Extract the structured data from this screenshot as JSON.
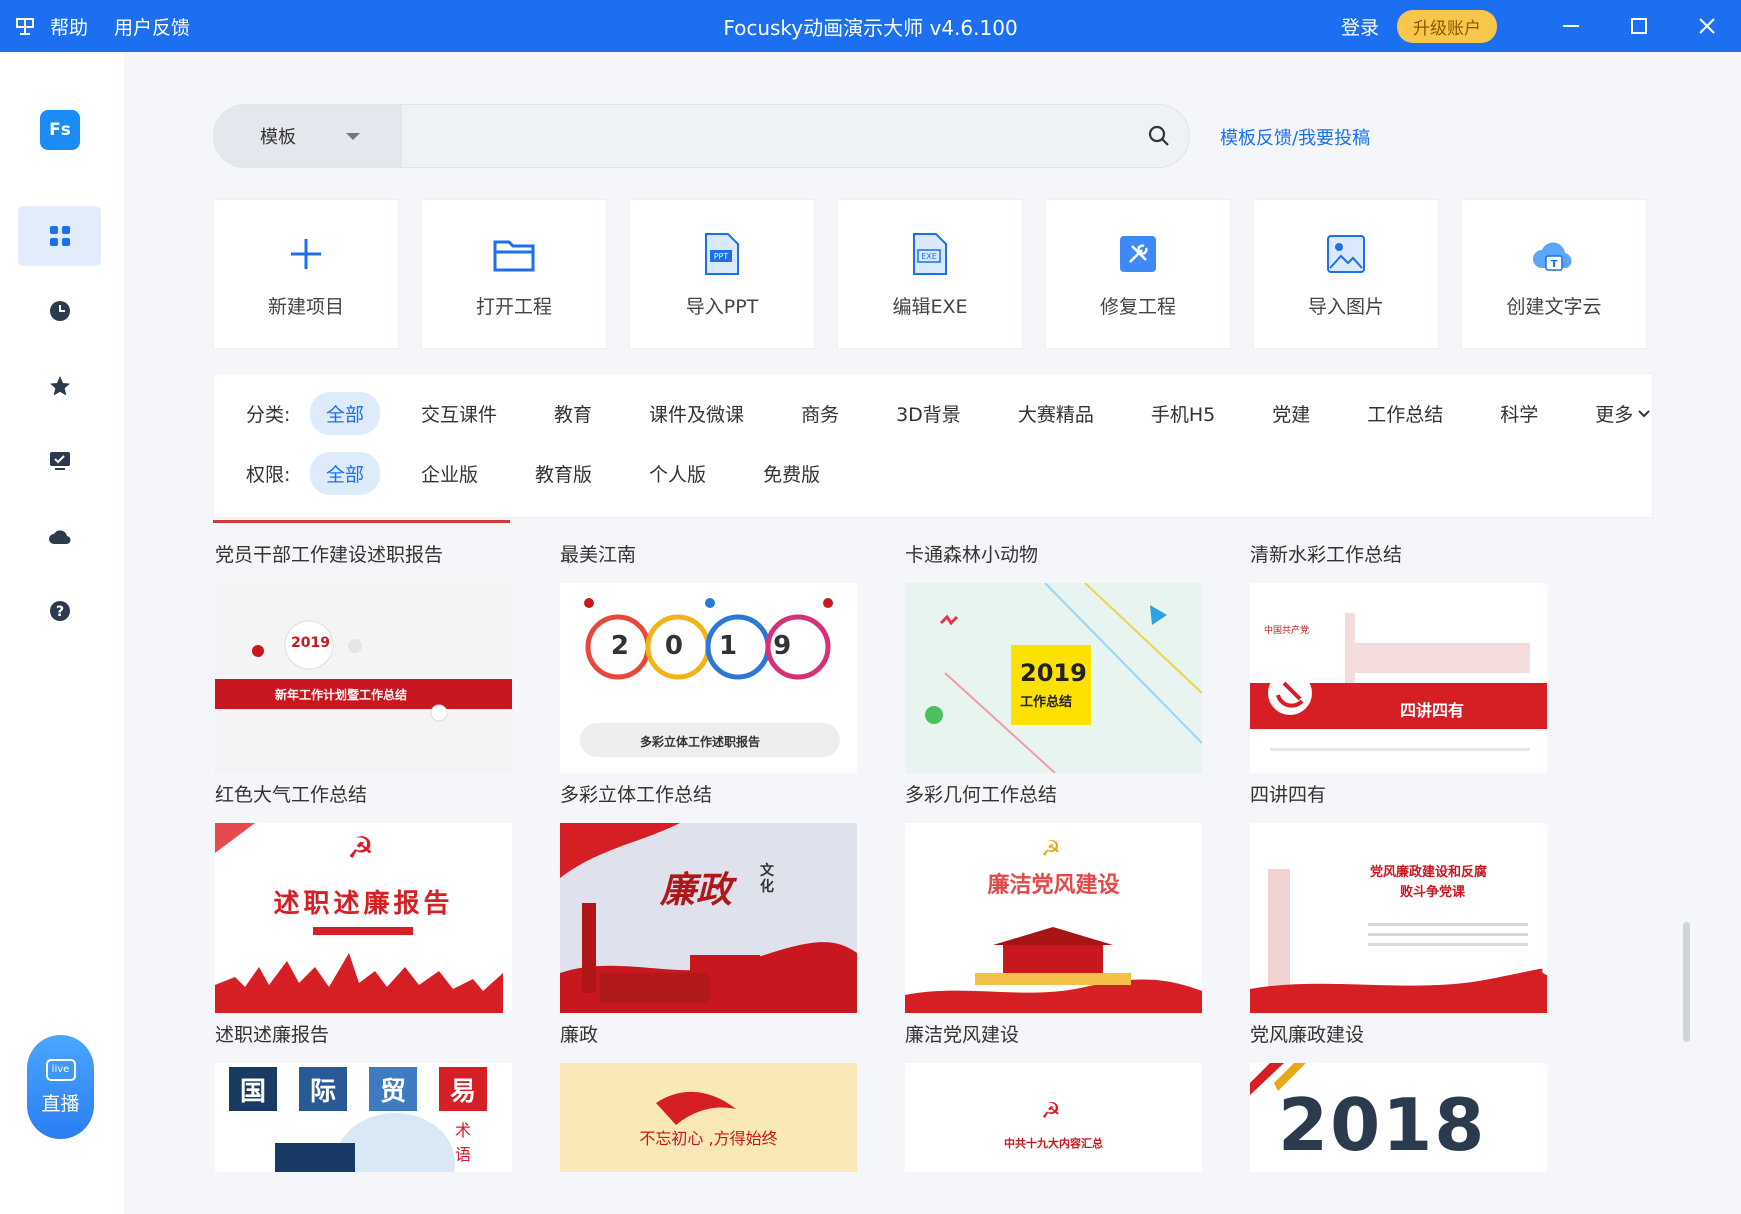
{
  "titlebar": {
    "menu": [
      "帮助",
      "用户反馈"
    ],
    "title": "Focusky动画演示大师 v4.6.100",
    "login": "登录",
    "upgrade": "升级账户"
  },
  "sidebar": {
    "logo": "Fs",
    "live_label": "直播",
    "live_badge": "live"
  },
  "search": {
    "type": "模板",
    "placeholder": "",
    "feedback_link": "模板反馈/我要投稿"
  },
  "actions": [
    {
      "label": "新建项目",
      "icon": "plus-icon"
    },
    {
      "label": "打开工程",
      "icon": "folder-icon"
    },
    {
      "label": "导入PPT",
      "icon": "ppt-file-icon"
    },
    {
      "label": "编辑EXE",
      "icon": "exe-file-icon"
    },
    {
      "label": "修复工程",
      "icon": "repair-tools-icon"
    },
    {
      "label": "导入图片",
      "icon": "image-icon"
    },
    {
      "label": "创建文字云",
      "icon": "word-cloud-icon"
    }
  ],
  "filters": {
    "category_label": "分类:",
    "categories": [
      "全部",
      "交互课件",
      "教育",
      "课件及微课",
      "商务",
      "3D背景",
      "大赛精品",
      "手机H5",
      "党建",
      "工作总结",
      "科学",
      "更多"
    ],
    "permission_label": "权限:",
    "permissions": [
      "全部",
      "企业版",
      "教育版",
      "个人版",
      "免费版"
    ]
  },
  "templates": {
    "row0": [
      "党员干部工作建设述职报告",
      "最美江南",
      "卡通森林小动物",
      "清新水彩工作总结"
    ],
    "row1": [
      {
        "title": "红色大气工作总结",
        "thumb_text": "2019",
        "thumb_sub": "新年工作计划暨工作总结"
      },
      {
        "title": "多彩立体工作总结",
        "thumb_text": "2019",
        "thumb_sub": "多彩立体工作述职报告"
      },
      {
        "title": "多彩几何工作总结",
        "thumb_text": "2019",
        "thumb_sub": "工作总结"
      },
      {
        "title": "四讲四有",
        "thumb_text": "四讲四有",
        "thumb_sub": "中国共产党"
      }
    ],
    "row2": [
      {
        "title": "述职述廉报告",
        "thumb_text": "述职述廉报告"
      },
      {
        "title": "廉政",
        "thumb_text": "廉政",
        "thumb_sub": "文化"
      },
      {
        "title": "廉洁党风建设",
        "thumb_text": "廉洁党风建设"
      },
      {
        "title": "党风廉政建设",
        "thumb_text": "党风廉政建设和反腐",
        "thumb_sub": "败斗争党课"
      }
    ],
    "row3": [
      {
        "thumb_chars": [
          "国",
          "际",
          "贸",
          "易"
        ],
        "thumb_sub": "术语"
      },
      {
        "thumb_text": "不忘初心 ,方得始终"
      },
      {
        "thumb_text": "中共十九大内容汇总"
      },
      {
        "thumb_text": "2018"
      }
    ]
  }
}
